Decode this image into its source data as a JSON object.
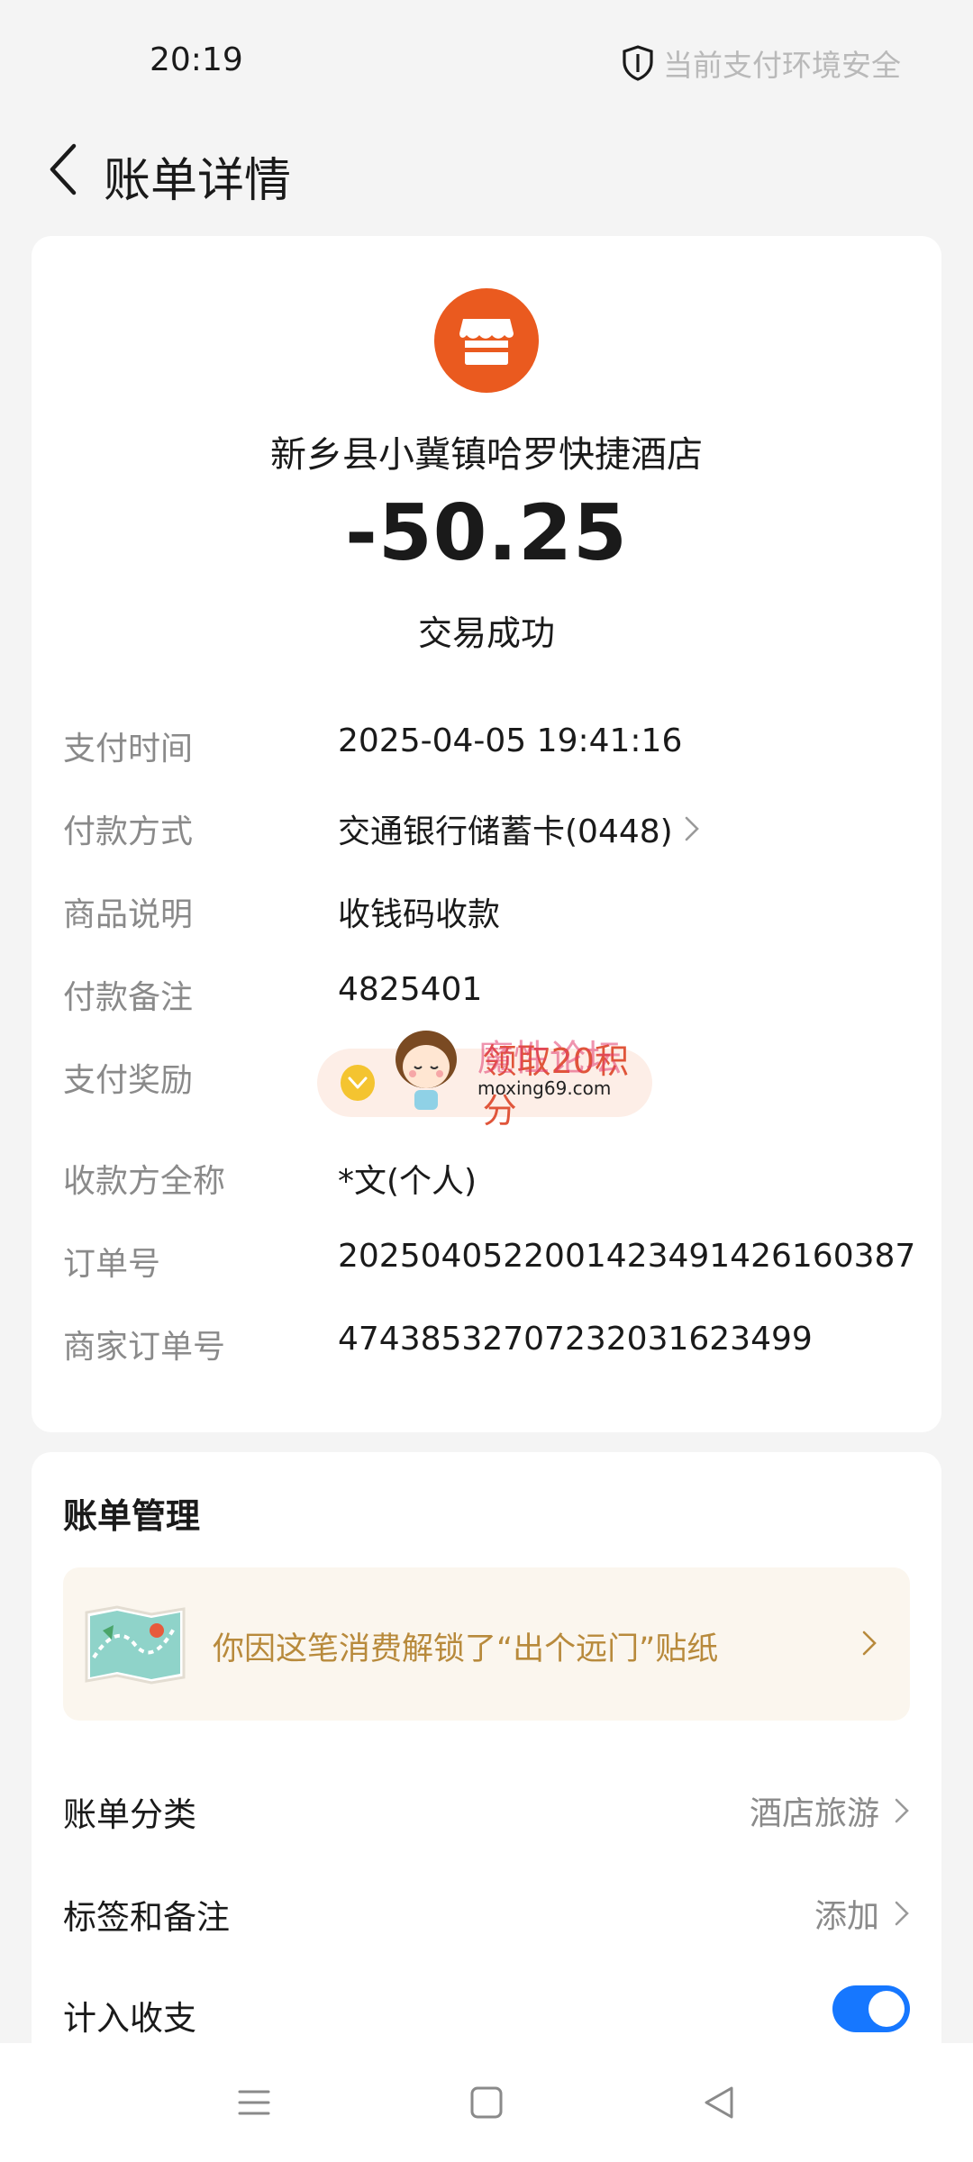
{
  "status_bar": {
    "time": "20:19",
    "security_text": "当前支付环境安全",
    "security_icon": "shield-icon"
  },
  "header": {
    "title": "账单详情",
    "back_icon": "chevron-left-icon"
  },
  "transaction": {
    "merchant_icon": "store-icon",
    "merchant_icon_color": "#ea5a1f",
    "merchant_name": "新乡县小冀镇哈罗快捷酒店",
    "amount": "-50.25",
    "status": "交易成功"
  },
  "details": [
    {
      "label": "支付时间",
      "value": "2025-04-05 19:41:16"
    },
    {
      "label": "付款方式",
      "value": "交通银行储蓄卡(0448)"
    },
    {
      "label": "商品说明",
      "value": "收钱码收款"
    },
    {
      "label": "付款备注",
      "value": "4825401"
    },
    {
      "label": "支付奖励",
      "value": "领取20积分"
    },
    {
      "label": "收款方全称",
      "value": "*文(个人)"
    },
    {
      "label": "订单号",
      "value": "2025040522001423491426160387"
    },
    {
      "label": "商家订单号",
      "value": "47438532707232031623499"
    }
  ],
  "watermark": {
    "title": "魔性论坛",
    "url": "moxing69.com"
  },
  "management": {
    "title": "账单管理",
    "sticker_text": "你因这笔消费解锁了“出个远门”贴纸",
    "sticker_icon": "map-sticker-icon",
    "category_label": "账单分类",
    "category_value": "酒店旅游",
    "tags_label": "标签和备注",
    "tags_value": "添加",
    "count_label": "计入收支",
    "count_enabled": true,
    "accent_color": "#1677ff"
  },
  "system_nav": {
    "menu_icon": "menu-icon",
    "home_icon": "home-square-icon",
    "back_icon": "back-triangle-icon"
  }
}
